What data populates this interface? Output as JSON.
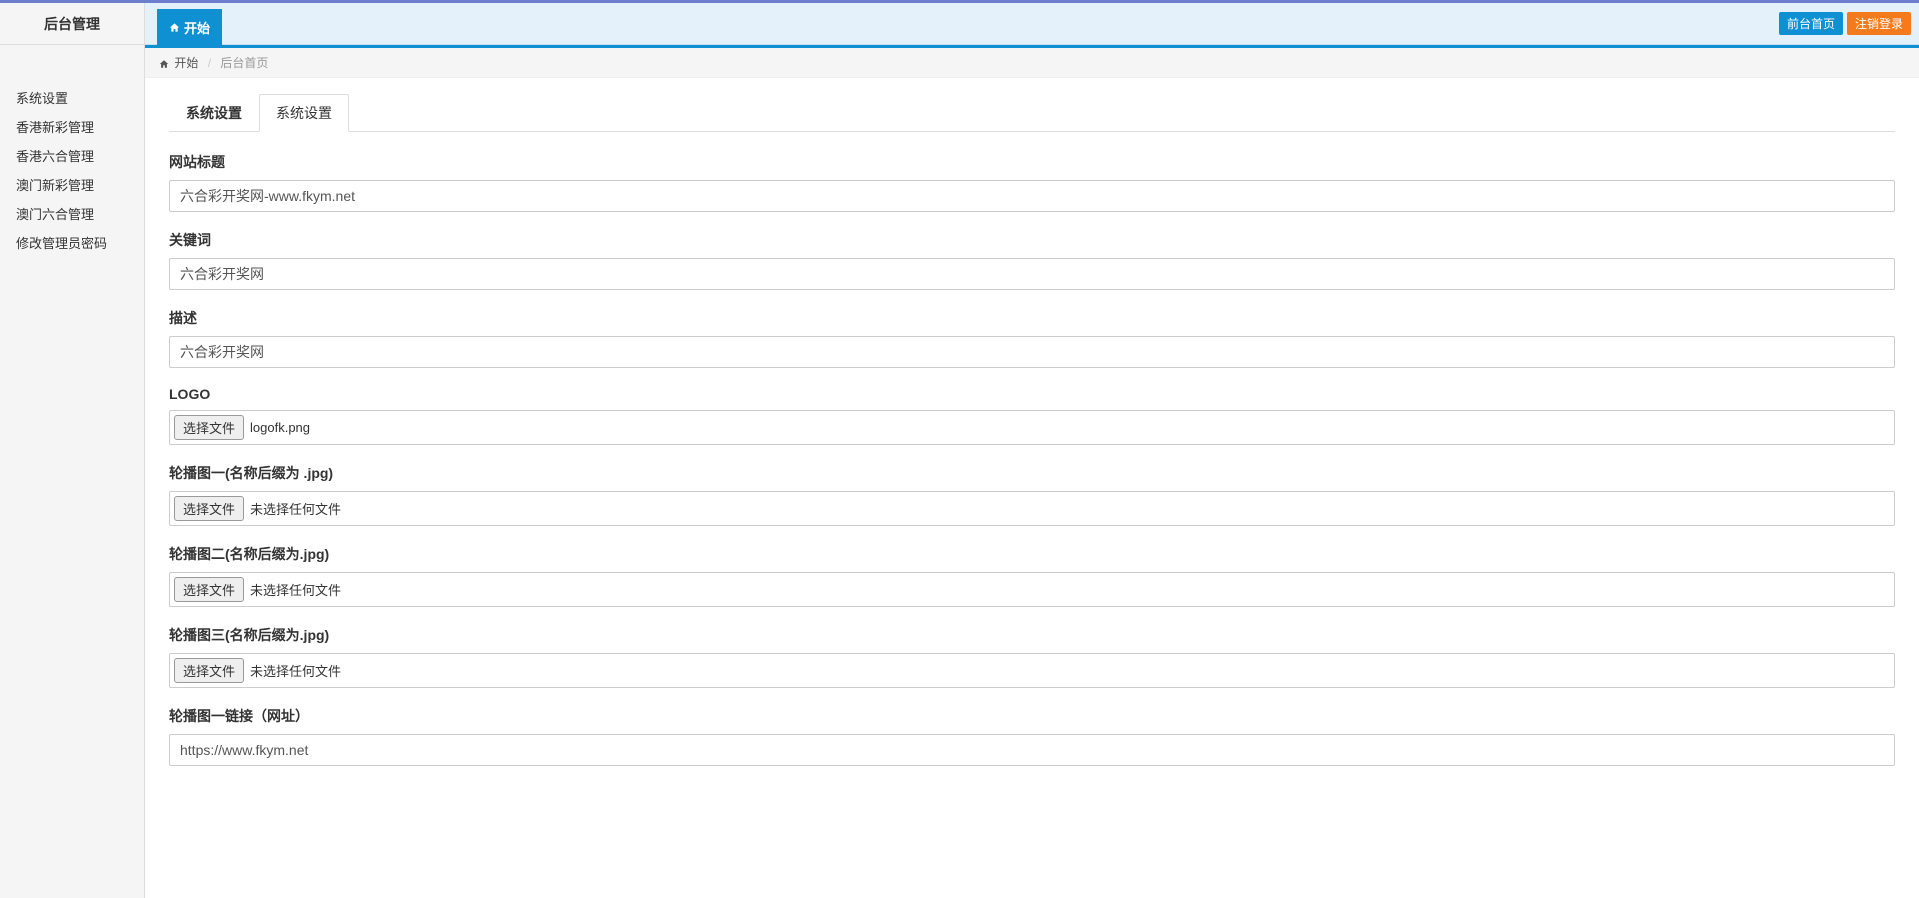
{
  "brand": "后台管理",
  "topbar": {
    "tab_label": "开始",
    "actions": {
      "front_home": "前台首页",
      "logout": "注销登录"
    }
  },
  "breadcrumb": {
    "home": "开始",
    "current": "后台首页"
  },
  "sidebar": {
    "items": [
      "系统设置",
      "香港新彩管理",
      "香港六合管理",
      "澳门新彩管理",
      "澳门六合管理",
      "修改管理员密码"
    ]
  },
  "tabs": {
    "t1": "系统设置",
    "t2": "系统设置"
  },
  "form": {
    "site_title": {
      "label": "网站标题",
      "value": "六合彩开奖网-www.fkym.net"
    },
    "keywords": {
      "label": "关键词",
      "value": "六合彩开奖网"
    },
    "description": {
      "label": "描述",
      "value": "六合彩开奖网"
    },
    "logo": {
      "label": "LOGO",
      "button": "选择文件",
      "filename": "logofk.png"
    },
    "carousel1": {
      "label": "轮播图一(名称后缀为 .jpg)",
      "button": "选择文件",
      "filename": "未选择任何文件"
    },
    "carousel2": {
      "label": "轮播图二(名称后缀为.jpg)",
      "button": "选择文件",
      "filename": "未选择任何文件"
    },
    "carousel3": {
      "label": "轮播图三(名称后缀为.jpg)",
      "button": "选择文件",
      "filename": "未选择任何文件"
    },
    "carousel1_link": {
      "label": "轮播图一链接（网址）",
      "value": "https://www.fkym.net"
    }
  }
}
